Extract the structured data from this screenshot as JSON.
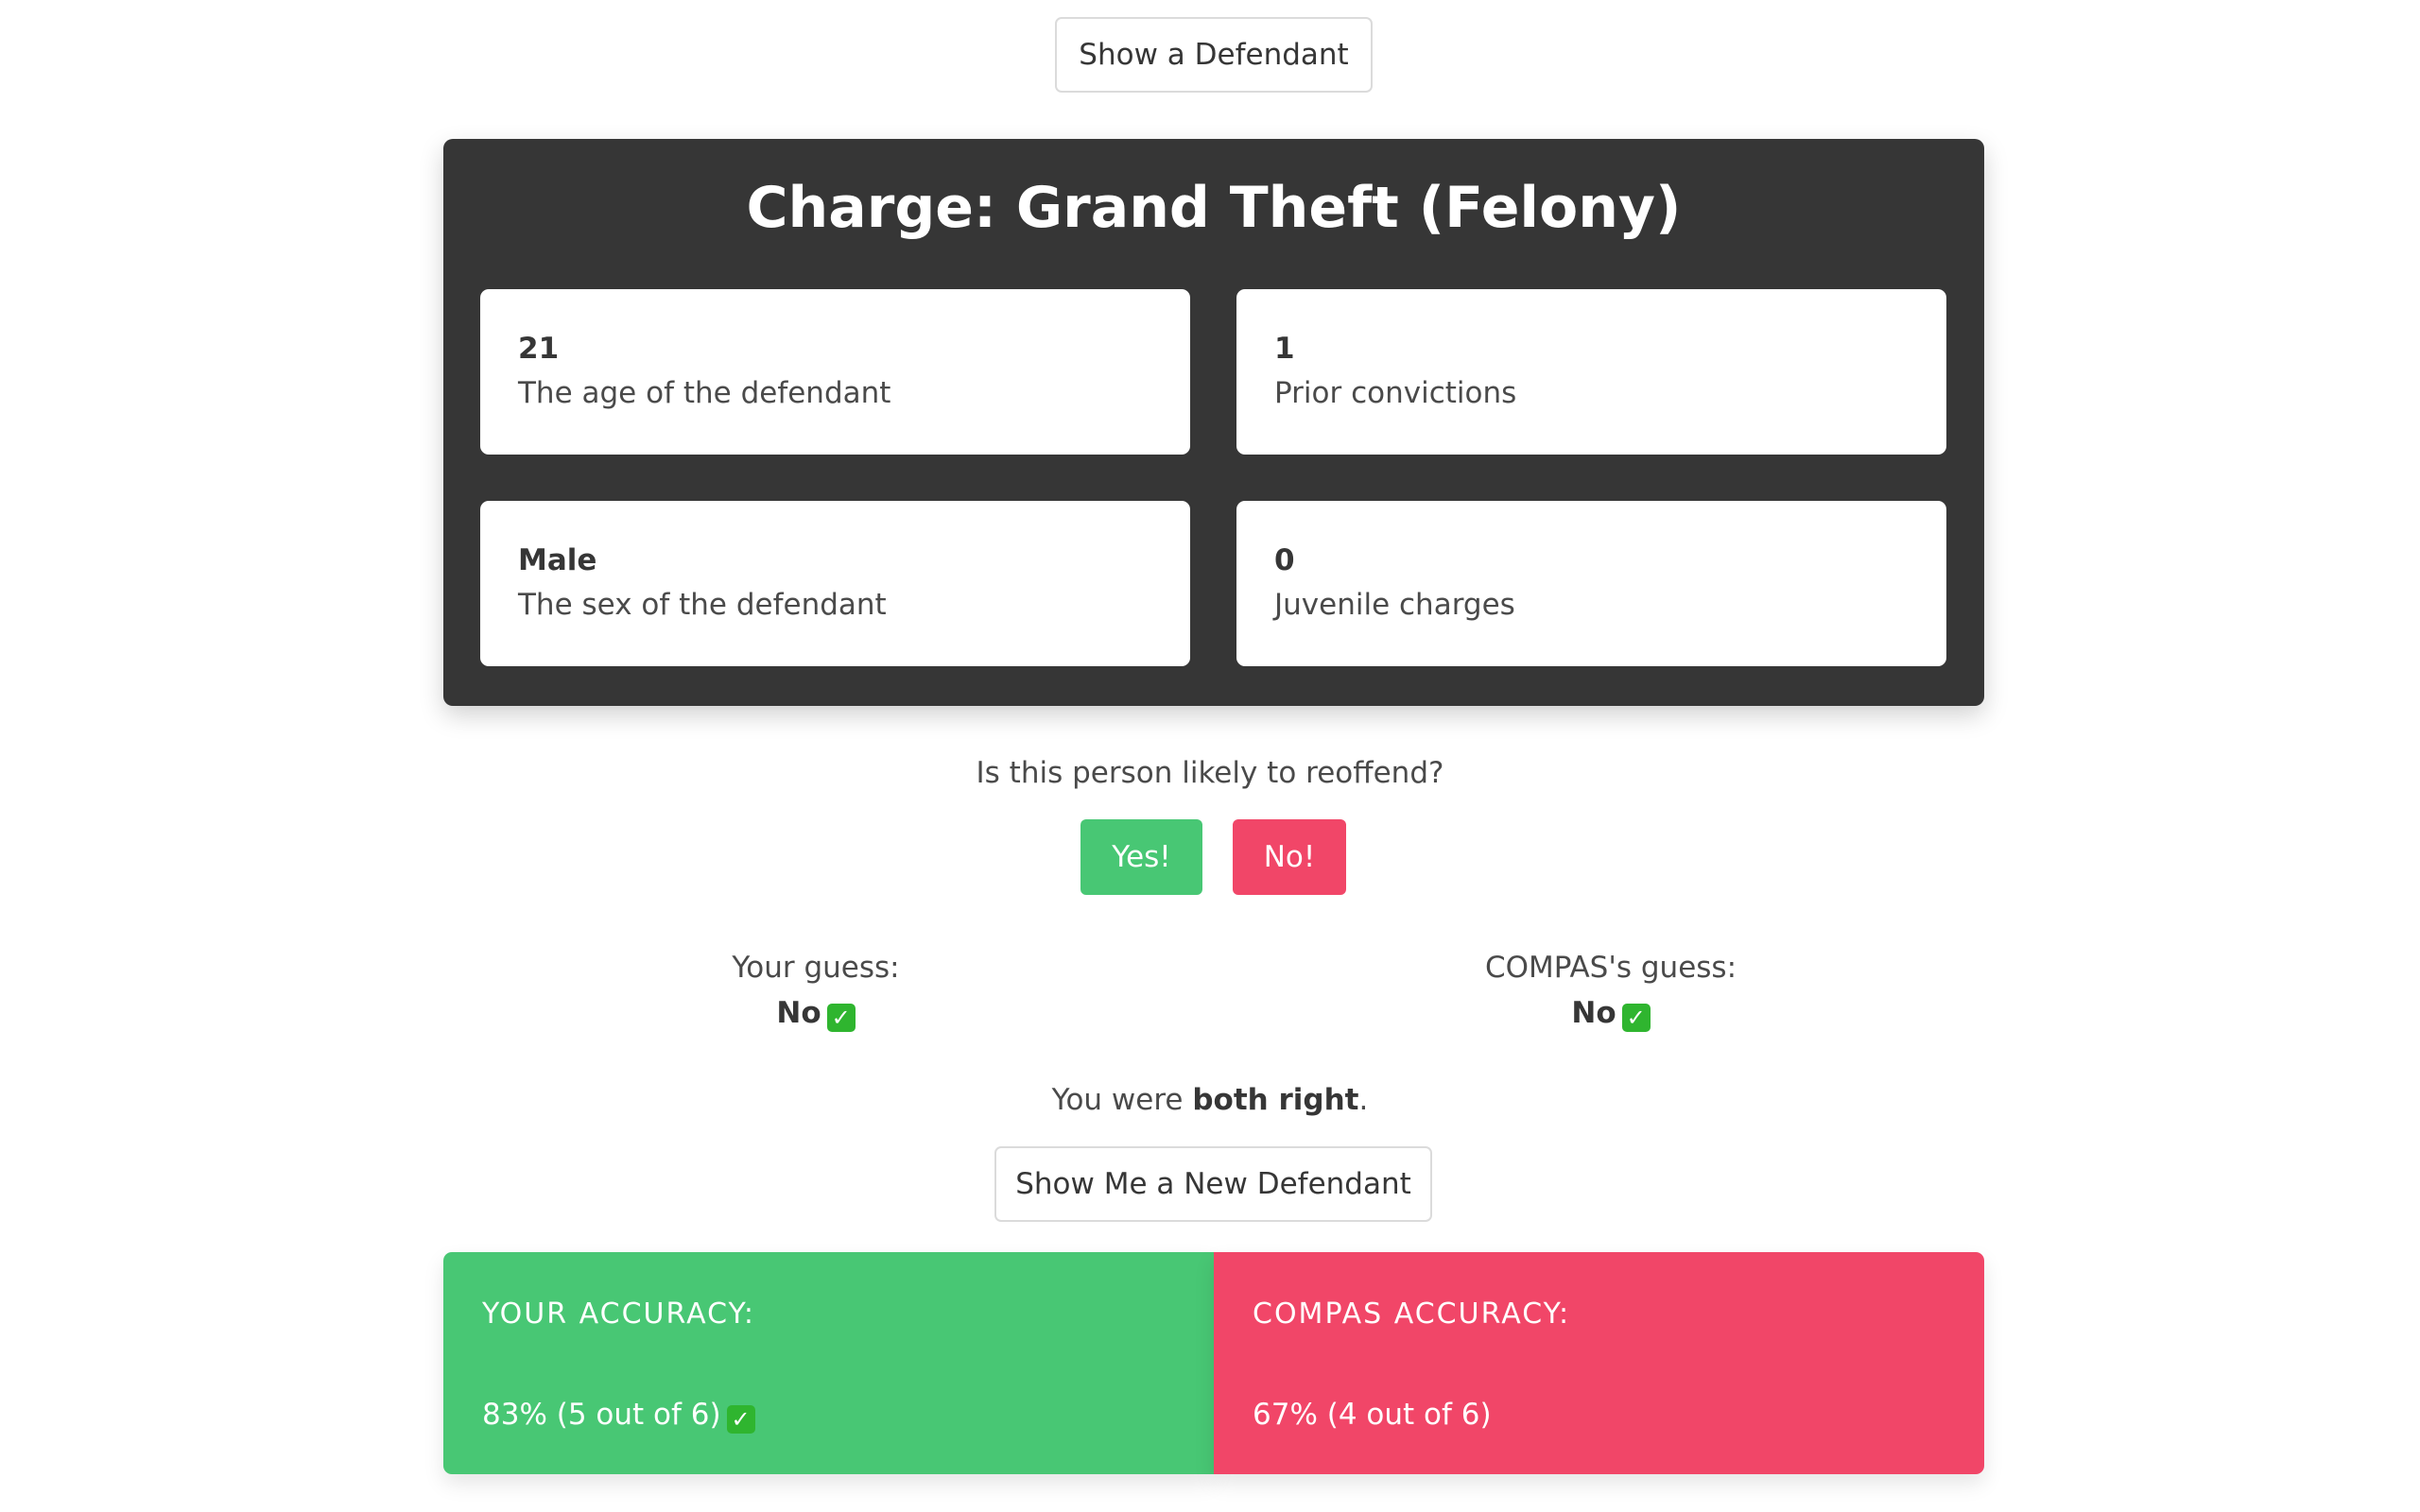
{
  "top_button": "Show a Defendant",
  "charge": {
    "title": "Charge: Grand Theft (Felony)",
    "cards": [
      {
        "value": "21",
        "label": "The age of the defendant"
      },
      {
        "value": "1",
        "label": "Prior convictions"
      },
      {
        "value": "Male",
        "label": "The sex of the defendant"
      },
      {
        "value": "0",
        "label": "Juvenile charges"
      }
    ]
  },
  "question": "Is this person likely to reoffend?",
  "buttons": {
    "yes": "Yes!",
    "no": "No!"
  },
  "guesses": {
    "your": {
      "label": "Your guess:",
      "value": "No",
      "icon": "check-mark-icon"
    },
    "compas": {
      "label": "COMPAS's guess:",
      "value": "No",
      "icon": "check-mark-icon"
    }
  },
  "result": {
    "prefix": "You were ",
    "emphasis": "both right",
    "suffix": "."
  },
  "new_button": "Show Me a New Defendant",
  "accuracy": {
    "your": {
      "title": "YOUR ACCURACY:",
      "value": "83% (5 out of 6)",
      "percent": 83,
      "correct": 5,
      "total": 6,
      "icon": "check-mark-icon"
    },
    "compas": {
      "title": "COMPAS ACCURACY:",
      "value": "67% (4 out of 6)",
      "percent": 67,
      "correct": 4,
      "total": 6
    }
  },
  "colors": {
    "green": "#48c774",
    "red": "#f14668",
    "dark": "#363636",
    "check": "#2fb52f"
  }
}
